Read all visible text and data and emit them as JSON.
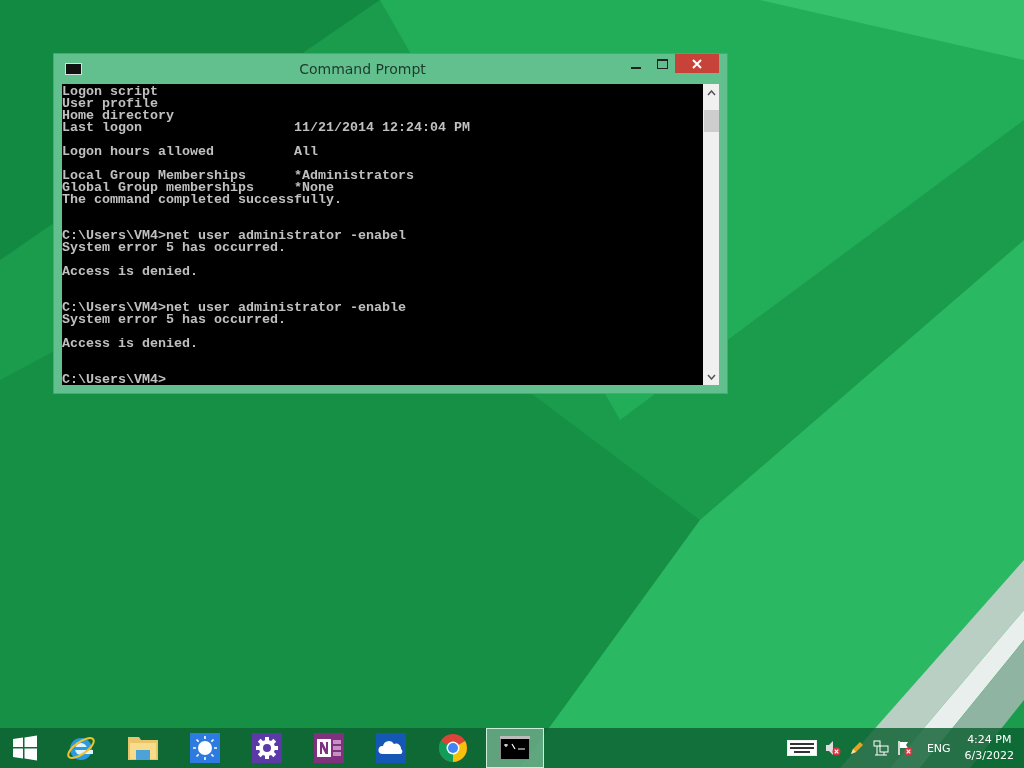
{
  "window": {
    "title": "Command Prompt",
    "console": [
      {
        "kind": "output",
        "lines": [
          "Logon script",
          "User profile",
          "Home directory",
          "Last logon                   11/21/2014 12:24:04 PM"
        ]
      },
      {
        "kind": "output",
        "lines": [
          "Logon hours allowed          All"
        ]
      },
      {
        "kind": "output",
        "lines": [
          "Local Group Memberships      *Administrators",
          "Global Group memberships     *None",
          "The command completed successfully."
        ]
      },
      {
        "kind": "command",
        "lines": [
          "C:\\Users\\VM4>net user administrator -enabel",
          "System error 5 has occurred."
        ]
      },
      {
        "kind": "output",
        "lines": [
          "Access is denied."
        ]
      },
      {
        "kind": "command",
        "lines": [
          "C:\\Users\\VM4>net user administrator -enable",
          "System error 5 has occurred."
        ]
      },
      {
        "kind": "output",
        "lines": [
          "Access is denied."
        ]
      },
      {
        "kind": "command",
        "lines": [
          "C:\\Users\\VM4>"
        ]
      }
    ]
  },
  "taskbar": {
    "apps": [
      {
        "kind": "start",
        "selected": false
      },
      {
        "kind": "globe",
        "selected": false
      },
      {
        "kind": "folder",
        "selected": false
      },
      {
        "kind": "sun",
        "selected": false
      },
      {
        "kind": "gear",
        "selected": false
      },
      {
        "kind": "note",
        "selected": false
      },
      {
        "kind": "cloud",
        "selected": false
      },
      {
        "kind": "chrome",
        "selected": false
      },
      {
        "kind": "console",
        "selected": true
      }
    ],
    "tray": {
      "language": "ENG",
      "time": "4:24 PM",
      "date": "6/3/2022"
    }
  }
}
